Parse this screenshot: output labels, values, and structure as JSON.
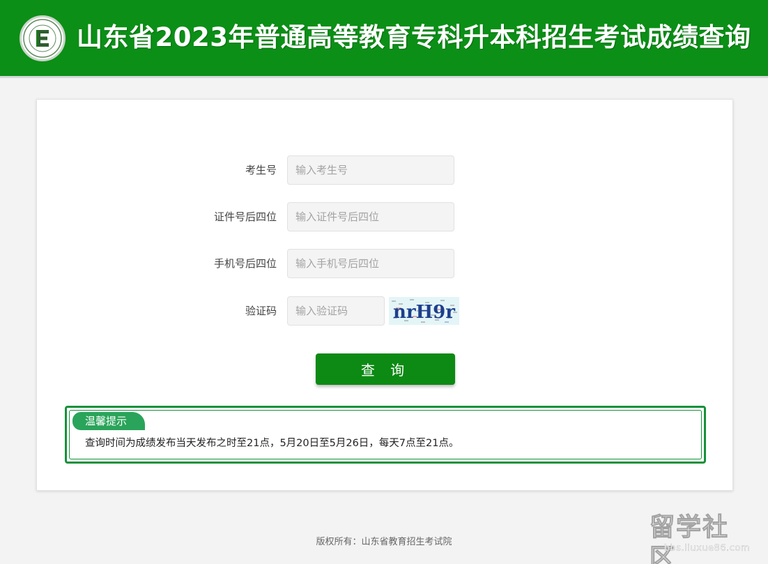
{
  "header": {
    "title": "山东省2023年普通高等教育专科升本科招生考试成绩查询",
    "logo_icon": "exam-institute-seal-icon",
    "bg_color": "#0b8f16"
  },
  "form": {
    "fields": [
      {
        "label": "考生号",
        "placeholder": "输入考生号",
        "value": ""
      },
      {
        "label": "证件号后四位",
        "placeholder": "输入证件号后四位",
        "value": ""
      },
      {
        "label": "手机号后四位",
        "placeholder": "输入手机号后四位",
        "value": ""
      },
      {
        "label": "验证码",
        "placeholder": "输入验证码",
        "value": ""
      }
    ],
    "captcha_text": "nrH9r",
    "submit_label": "查 询",
    "submit_color": "#0c8a14"
  },
  "notice": {
    "tab_label": "温馨提示",
    "text": "查询时间为成绩发布当天发布之时至21点，5月20日至5月26日，每天7点至21点。",
    "border_color": "#16913a"
  },
  "footer": {
    "text": "版权所有：山东省教育招生考试院"
  },
  "watermark": {
    "main": "留学社区",
    "sub": "bbs.liuxue86.com"
  }
}
